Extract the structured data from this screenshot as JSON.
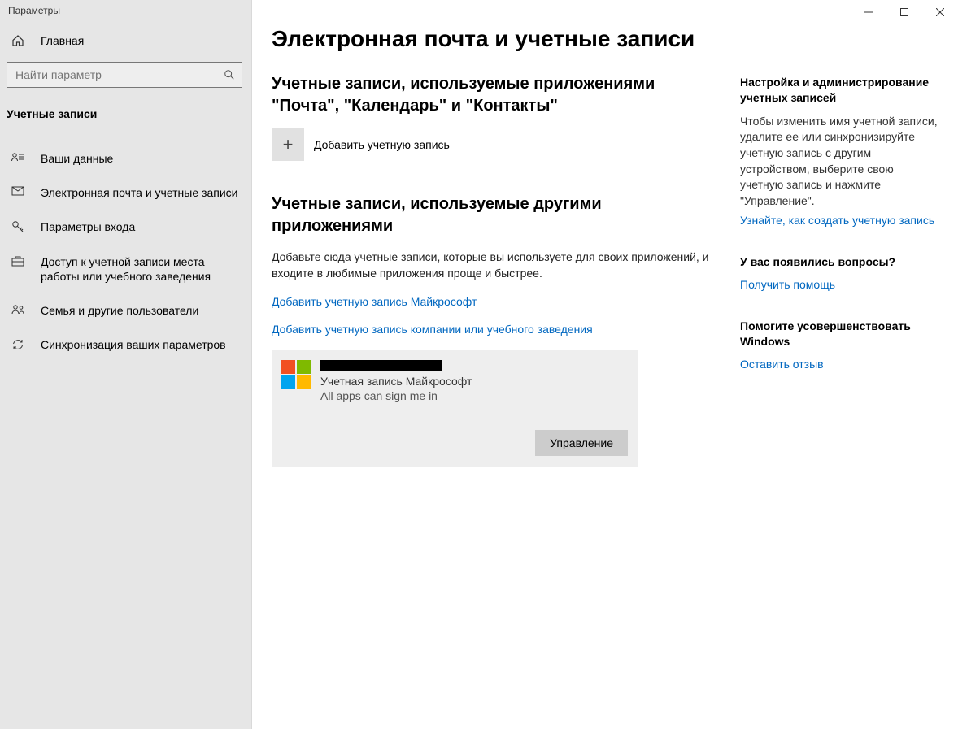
{
  "window": {
    "title": "Параметры"
  },
  "sidebar": {
    "home": "Главная",
    "search_placeholder": "Найти параметр",
    "section": "Учетные записи",
    "items": [
      {
        "label": "Ваши данные"
      },
      {
        "label": "Электронная почта и учетные записи"
      },
      {
        "label": "Параметры входа"
      },
      {
        "label": "Доступ к учетной записи места работы или учебного заведения"
      },
      {
        "label": "Семья и другие пользователи"
      },
      {
        "label": "Синхронизация ваших параметров"
      }
    ]
  },
  "main": {
    "h1": "Электронная почта и учетные записи",
    "section1_title": "Учетные записи, используемые приложениями \"Почта\", \"Календарь\" и \"Контакты\"",
    "add_account": "Добавить учетную запись",
    "section2_title": "Учетные записи, используемые другими приложениями",
    "section2_desc": "Добавьте сюда учетные записи, которые вы используете для своих приложений, и входите в любимые приложения проще и быстрее.",
    "link_ms": "Добавить учетную запись Майкрософт",
    "link_work": "Добавить учетную запись компании или учебного заведения",
    "account": {
      "type": "Учетная запись Майкрософт",
      "status": "All apps can sign me in",
      "manage": "Управление"
    }
  },
  "aside": {
    "block1_title": "Настройка и администрирование учетных записей",
    "block1_text": "Чтобы изменить имя учетной записи, удалите ее или синхронизируйте учетную запись с другим устройством, выберите свою учетную запись и нажмите \"Управление\".",
    "block1_link": "Узнайте, как создать учетную запись",
    "block2_title": "У вас появились вопросы?",
    "block2_link": "Получить помощь",
    "block3_title": "Помогите усовершенствовать Windows",
    "block3_link": "Оставить отзыв"
  }
}
